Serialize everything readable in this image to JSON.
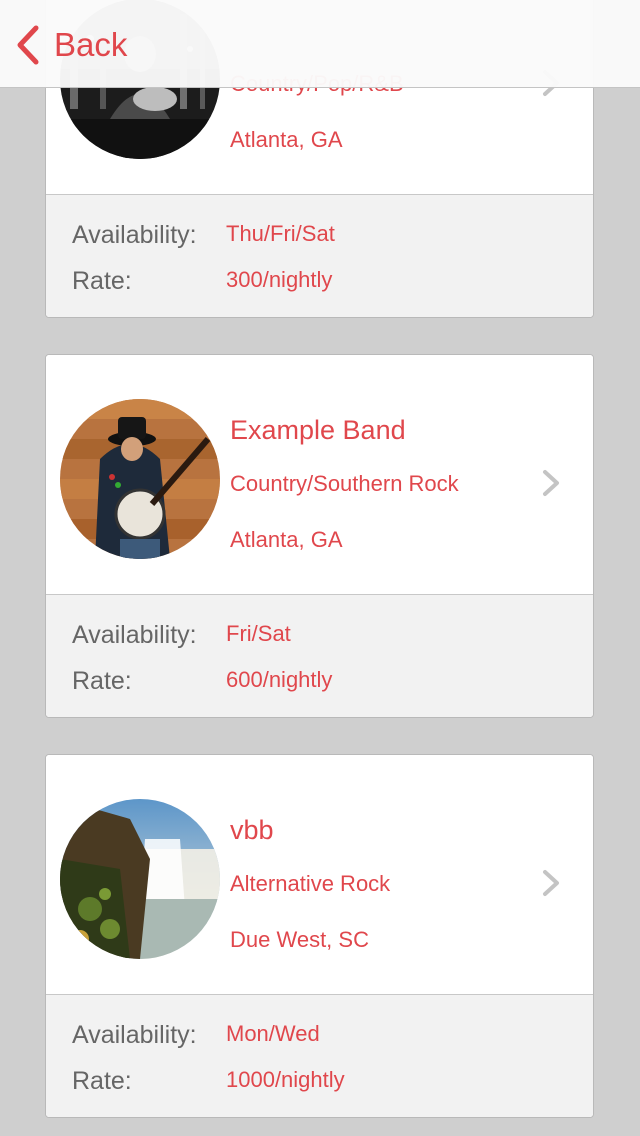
{
  "nav": {
    "back_label": "Back"
  },
  "colors": {
    "accent": "#e0474c",
    "label_gray": "#666666",
    "background": "#cfcfcf"
  },
  "bands": [
    {
      "name": "",
      "genre": "Country/Pop/R&B",
      "location": "Atlanta, GA",
      "availability_label": "Availability:",
      "availability": "Thu/Fri/Sat",
      "rate_label": "Rate:",
      "rate": "300/nightly",
      "avatar_icon": "concert-photo"
    },
    {
      "name": "Example Band",
      "genre": "Country/Southern Rock",
      "location": "Atlanta, GA",
      "availability_label": "Availability:",
      "availability": "Fri/Sat",
      "rate_label": "Rate:",
      "rate": "600/nightly",
      "avatar_icon": "banjo-player-photo"
    },
    {
      "name": "vbb",
      "genre": "Alternative Rock",
      "location": "Due West, SC",
      "availability_label": "Availability:",
      "availability": "Mon/Wed",
      "rate_label": "Rate:",
      "rate": "1000/nightly",
      "avatar_icon": "waterfall-photo"
    }
  ]
}
